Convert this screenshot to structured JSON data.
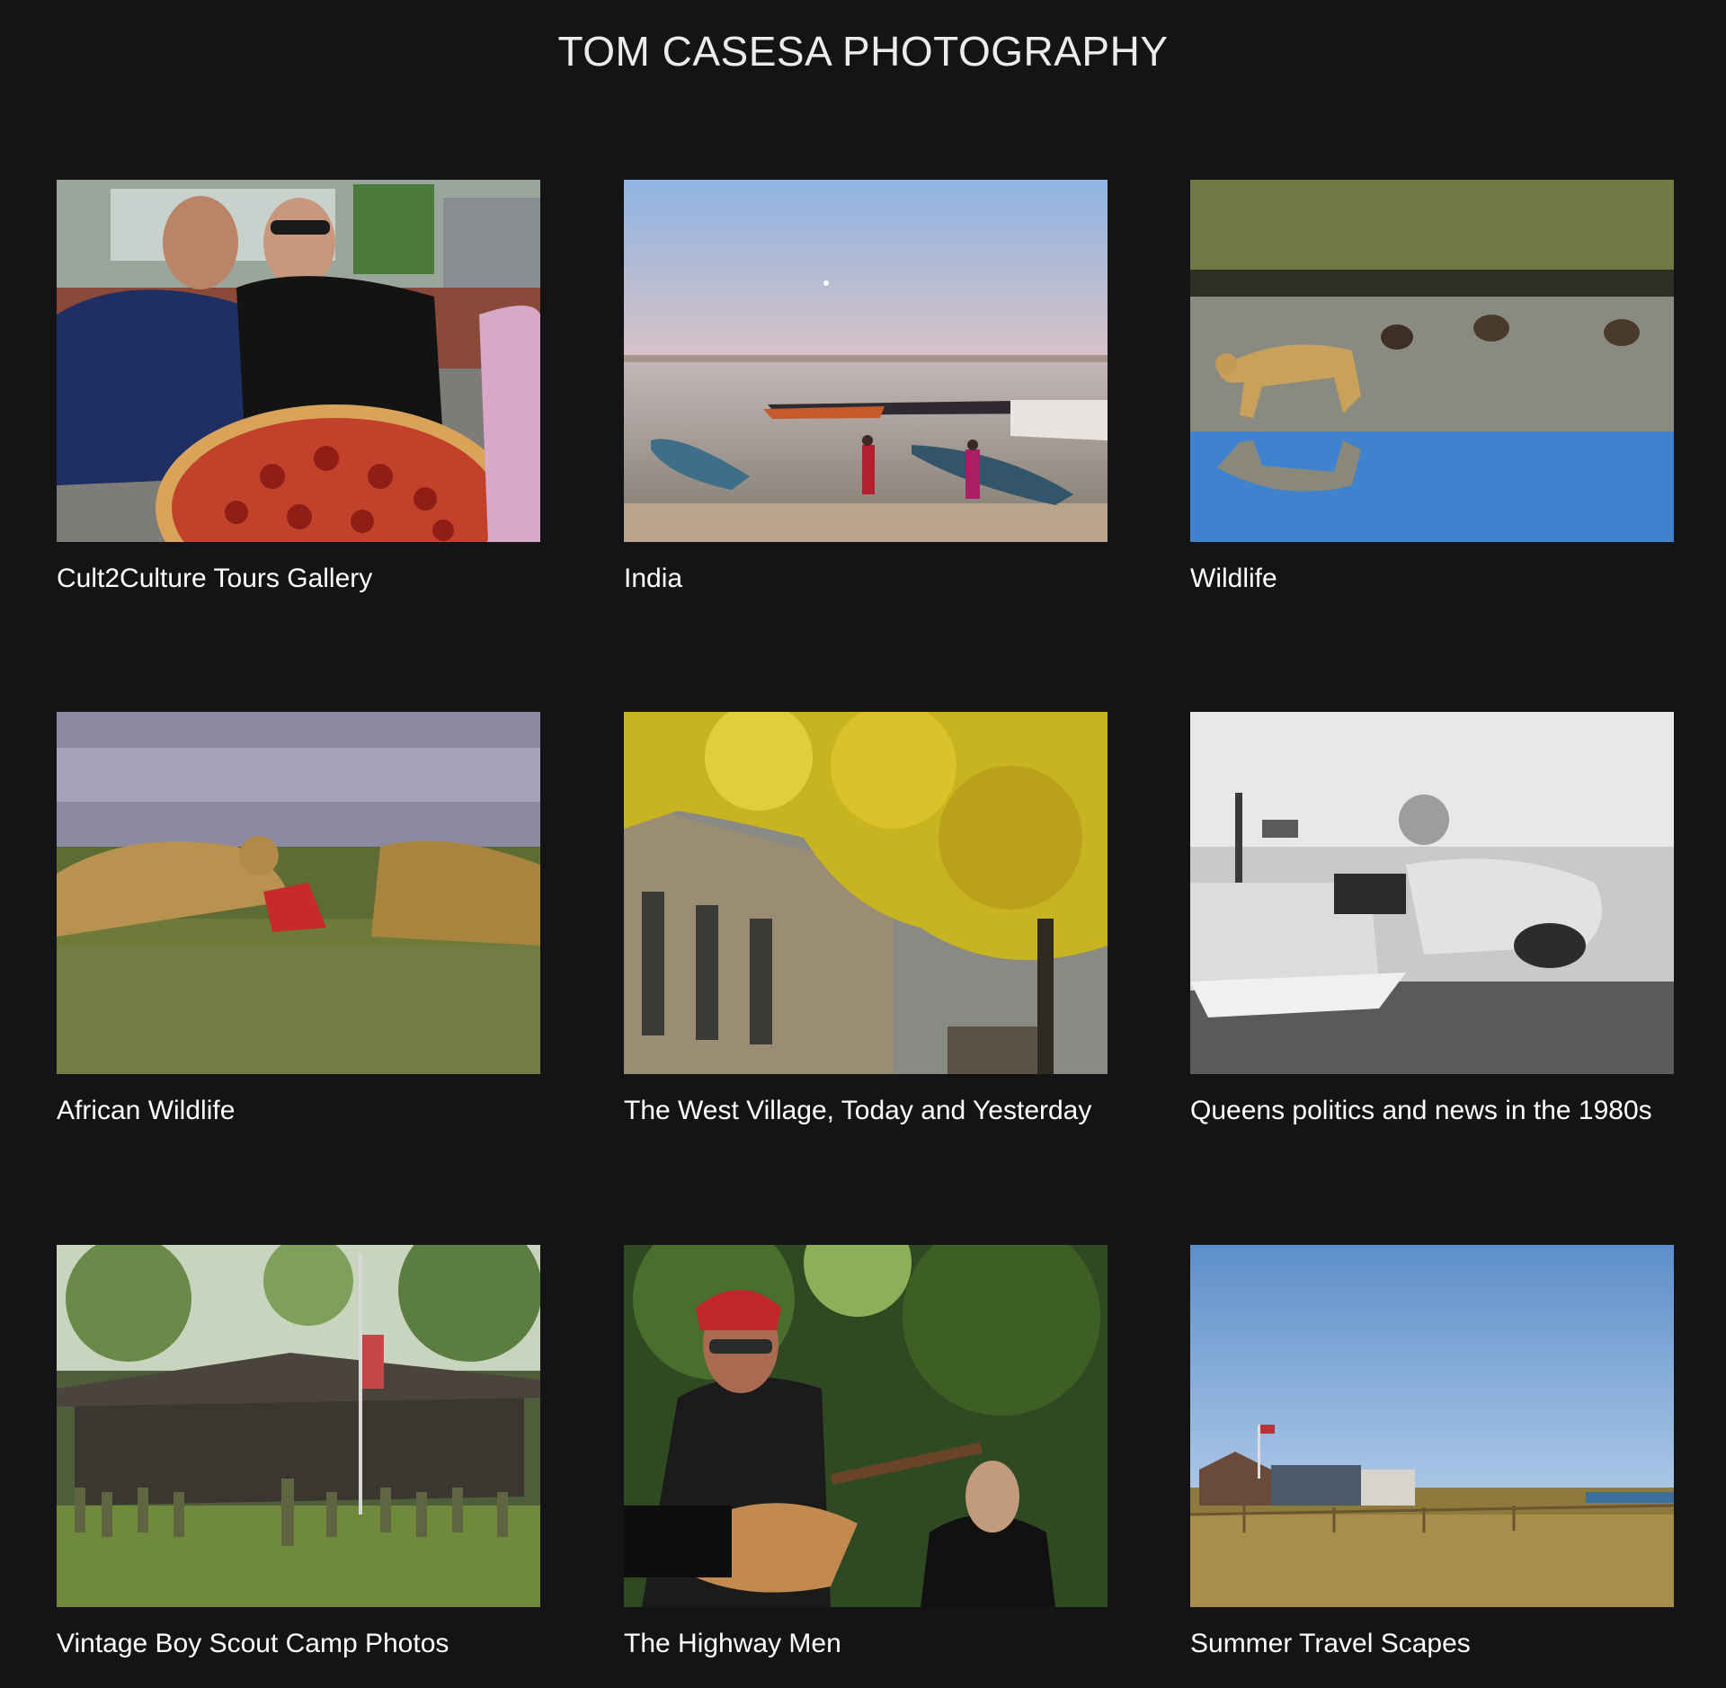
{
  "site": {
    "title": "TOM CASESA PHOTOGRAPHY"
  },
  "galleries": [
    {
      "title": "Cult2Culture Tours Gallery",
      "image": "two men holding large pizza"
    },
    {
      "title": "India",
      "image": "boats on river at dawn"
    },
    {
      "title": "Wildlife",
      "image": "cheetah walking past vultures"
    },
    {
      "title": "African Wildlife",
      "image": "cheetahs feeding in grass"
    },
    {
      "title": "The West Village, Today and Yesterday",
      "image": "yellow autumn tree by brick building"
    },
    {
      "title": "Queens politics and news in the 1980s",
      "image": "black and white plane in water with boat"
    },
    {
      "title": "Vintage Boy Scout Camp Photos",
      "image": "scouts saluting at flag pole"
    },
    {
      "title": "The Highway Men",
      "image": "singer with red bandana and guitar"
    },
    {
      "title": "Summer Travel Scapes",
      "image": "beach houses under blue sky"
    }
  ]
}
